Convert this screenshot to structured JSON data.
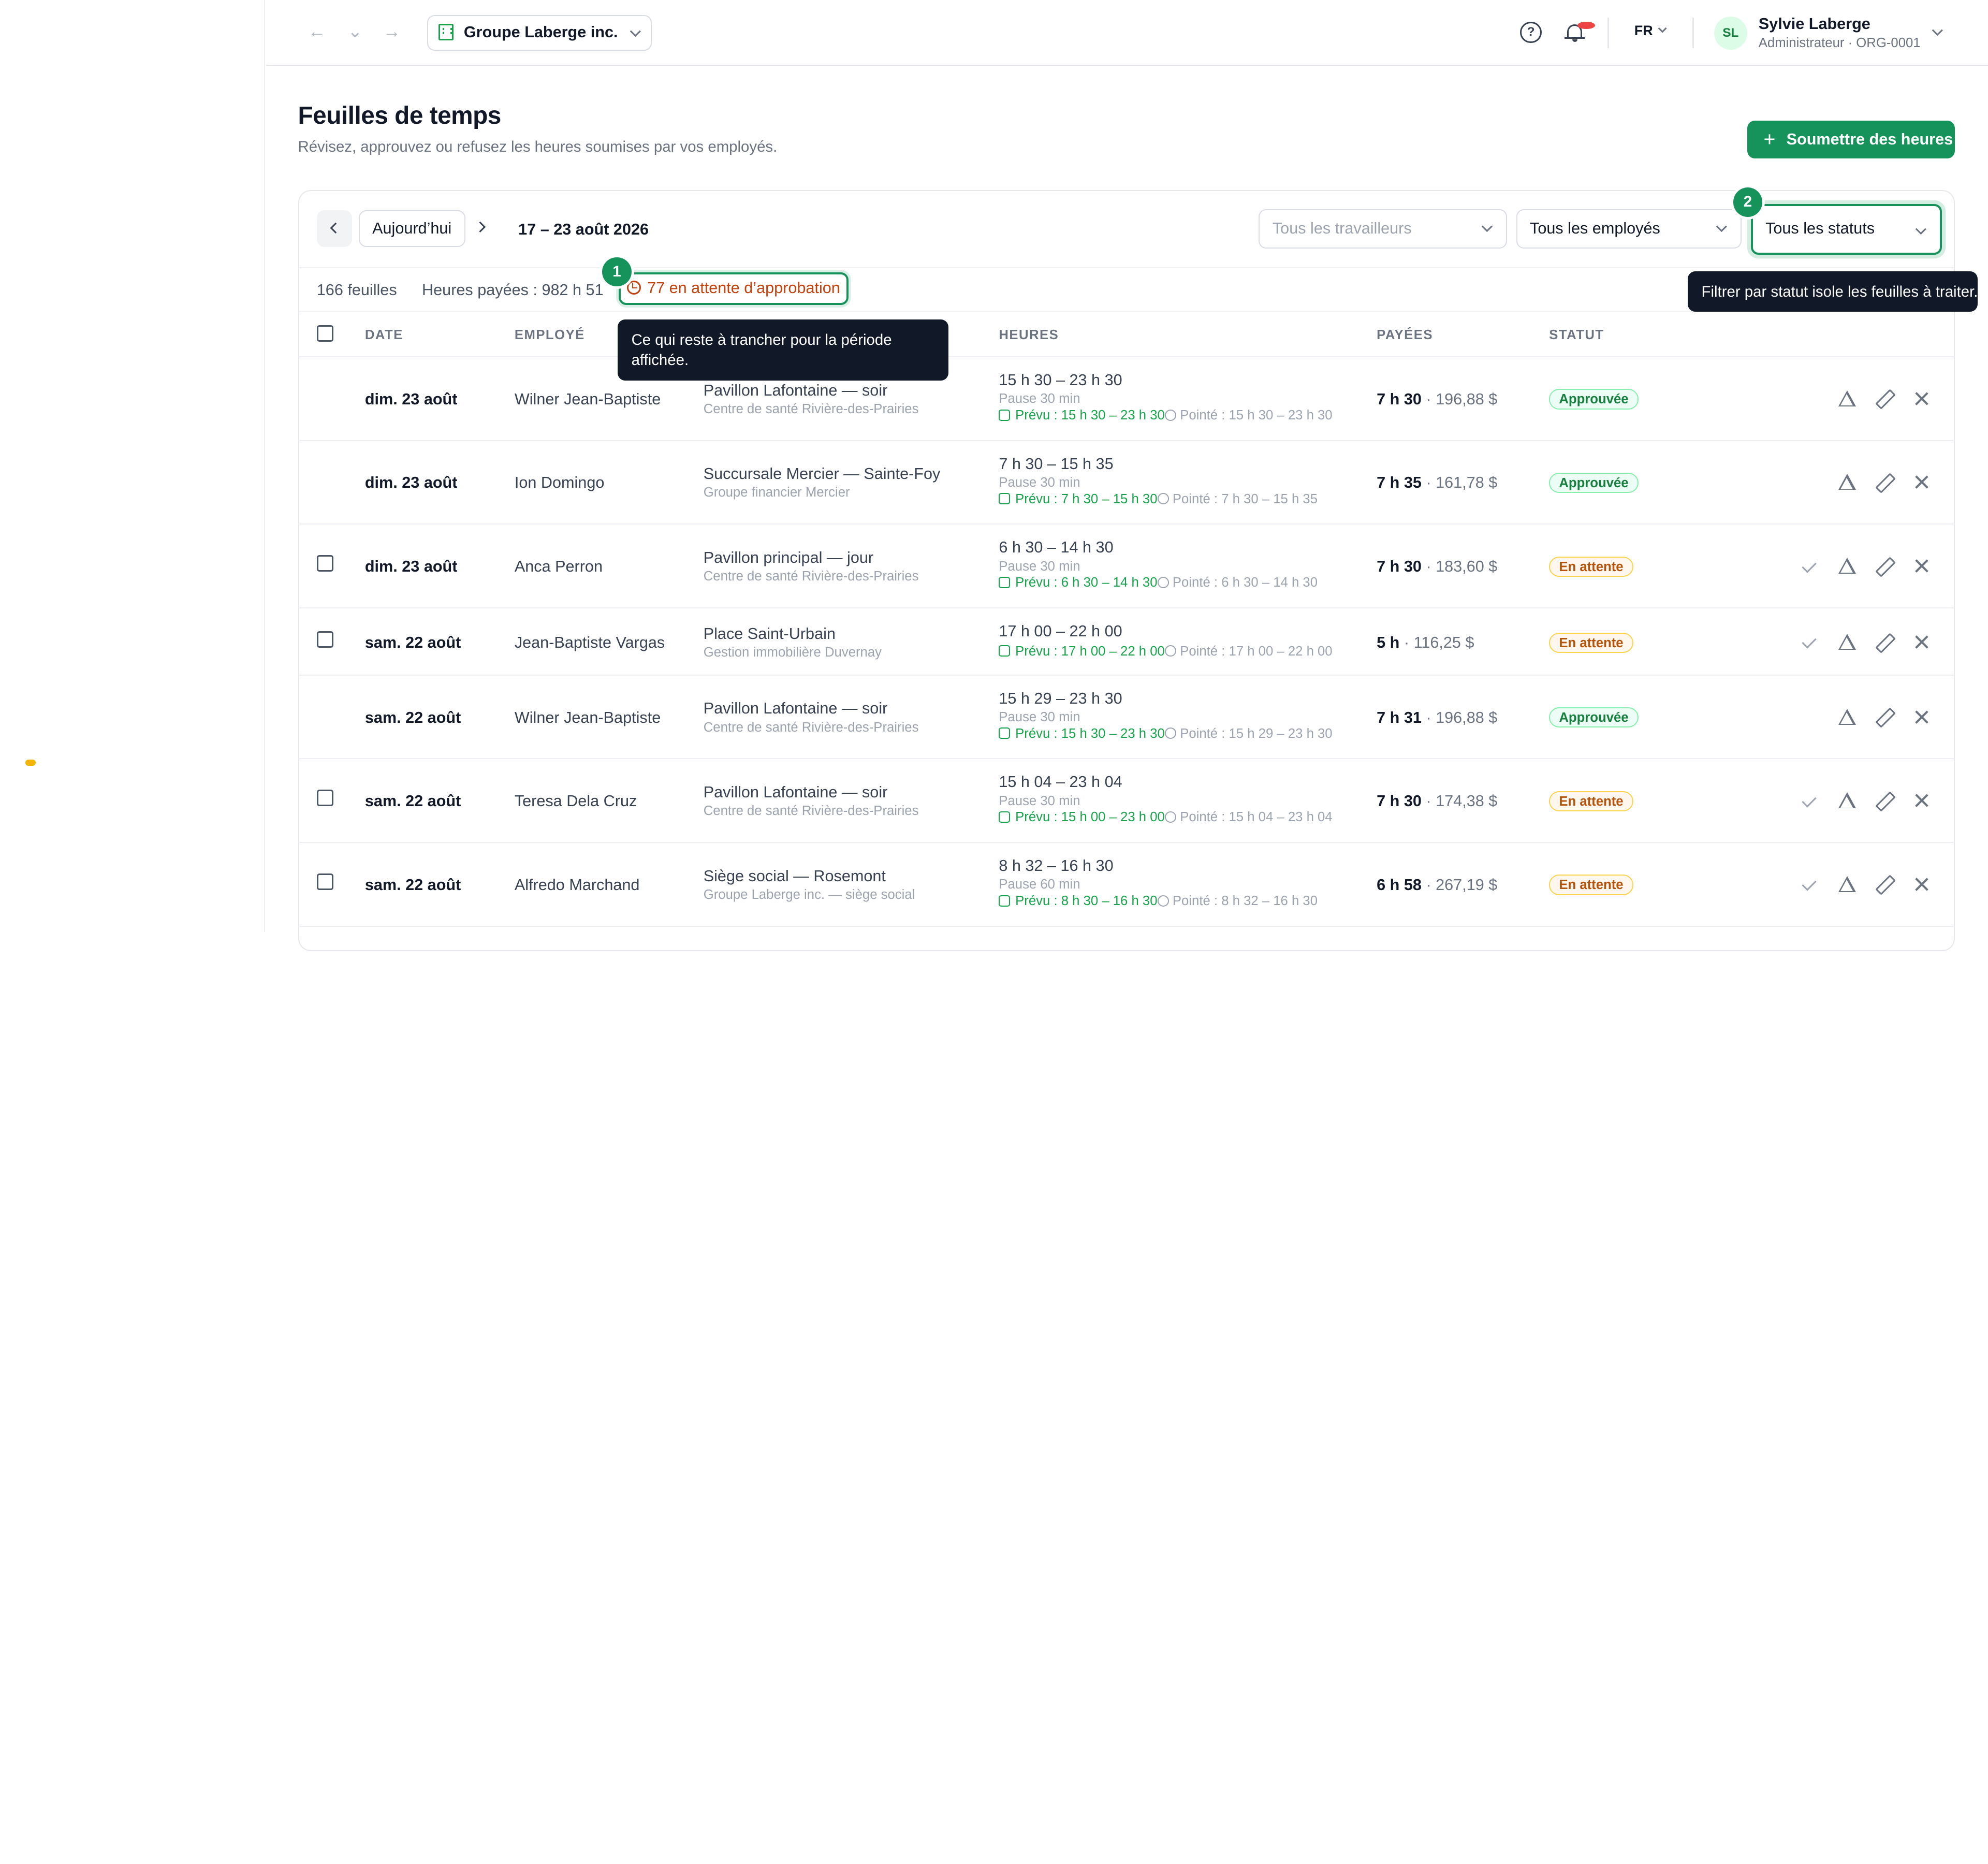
{
  "topbar": {
    "org_name": "Groupe Laberge inc.",
    "language": "FR",
    "user_initials": "SL",
    "user_name": "Sylvie Laberge",
    "user_role": "Administrateur · ORG-0001"
  },
  "page": {
    "title": "Feuilles de temps",
    "subtitle": "Révisez, approuvez ou refusez les heures soumises par vos employés.",
    "primary_action": "Soumettre des heures"
  },
  "toolbar": {
    "today": "Aujourd’hui",
    "period": "17 – 23 août 2026",
    "filter_workers_placeholder": "Tous les travailleurs",
    "filter_employees": "Tous les employés",
    "filter_status": "Tous les statuts"
  },
  "summary": {
    "count": "166 feuilles",
    "paid_hours": "Heures payées : 982 h 51",
    "pending": "77 en attente d’approbation"
  },
  "columns": {
    "date": "DATE",
    "employee": "EMPLOYÉ",
    "hours": "HEURES",
    "paid": "PAYÉES",
    "status": "STATUT"
  },
  "rows": [
    {
      "date": "dim. 23 août",
      "employee": "Wilner Jean-Baptiste",
      "site": "Pavillon Lafontaine — soir",
      "client": "Centre de santé Rivière-des-Prairies",
      "hours": "15 h 30 – 23 h 30",
      "pause": "Pause 30 min",
      "scheduled": "Prévu : 15 h 30 – 23 h 30",
      "punched": "Pointé : 15 h 30 – 23 h 30",
      "paid_hours": "7 h 30",
      "paid_amount": "· 196,88 $",
      "status": "Approuvée"
    },
    {
      "date": "dim. 23 août",
      "employee": "Ion Domingo",
      "site": "Succursale Mercier — Sainte-Foy",
      "client": "Groupe financier Mercier",
      "hours": "7 h 30 – 15 h 35",
      "pause": "Pause 30 min",
      "scheduled": "Prévu : 7 h 30 – 15 h 30",
      "punched": "Pointé : 7 h 30 – 15 h 35",
      "paid_hours": "7 h 35",
      "paid_amount": "· 161,78 $",
      "status": "Approuvée"
    },
    {
      "date": "dim. 23 août",
      "employee": "Anca Perron",
      "site": "Pavillon principal — jour",
      "client": "Centre de santé Rivière-des-Prairies",
      "hours": "6 h 30 – 14 h 30",
      "pause": "Pause 30 min",
      "scheduled": "Prévu : 6 h 30 – 14 h 30",
      "punched": "Pointé : 6 h 30 – 14 h 30",
      "paid_hours": "7 h 30",
      "paid_amount": "· 183,60 $",
      "status": "En attente"
    },
    {
      "date": "sam. 22 août",
      "employee": "Jean-Baptiste Vargas",
      "site": "Place Saint-Urbain",
      "client": "Gestion immobilière Duvernay",
      "hours": "17 h 00 – 22 h 00",
      "pause": "",
      "scheduled": "Prévu : 17 h 00 – 22 h 00",
      "punched": "Pointé : 17 h 00 – 22 h 00",
      "paid_hours": "5 h",
      "paid_amount": "· 116,25 $",
      "status": "En attente"
    },
    {
      "date": "sam. 22 août",
      "employee": "Wilner Jean-Baptiste",
      "site": "Pavillon Lafontaine — soir",
      "client": "Centre de santé Rivière-des-Prairies",
      "hours": "15 h 29 – 23 h 30",
      "pause": "Pause 30 min",
      "scheduled": "Prévu : 15 h 30 – 23 h 30",
      "punched": "Pointé : 15 h 29 – 23 h 30",
      "paid_hours": "7 h 31",
      "paid_amount": "· 196,88 $",
      "status": "Approuvée"
    },
    {
      "date": "sam. 22 août",
      "employee": "Teresa Dela Cruz",
      "site": "Pavillon Lafontaine — soir",
      "client": "Centre de santé Rivière-des-Prairies",
      "hours": "15 h 04 – 23 h 04",
      "pause": "Pause 30 min",
      "scheduled": "Prévu : 15 h 00 – 23 h 00",
      "punched": "Pointé : 15 h 04 – 23 h 04",
      "paid_hours": "7 h 30",
      "paid_amount": "· 174,38 $",
      "status": "En attente"
    },
    {
      "date": "sam. 22 août",
      "employee": "Alfredo Marchand",
      "site": "Siège social — Rosemont",
      "client": "Groupe Laberge inc. — siège social",
      "hours": "8 h 32 – 16 h 30",
      "pause": "Pause 60 min",
      "scheduled": "Prévu : 8 h 30 – 16 h 30",
      "punched": "Pointé : 8 h 32 – 16 h 30",
      "paid_hours": "6 h 58",
      "paid_amount": "· 267,19 $",
      "status": "En attente"
    }
  ],
  "walkthrough": {
    "step1_number": "1",
    "step1_text": "Ce qui reste à trancher pour la période affichée.",
    "step2_number": "2",
    "step2_text": "Filtrer par statut isole les feuilles à traiter."
  }
}
